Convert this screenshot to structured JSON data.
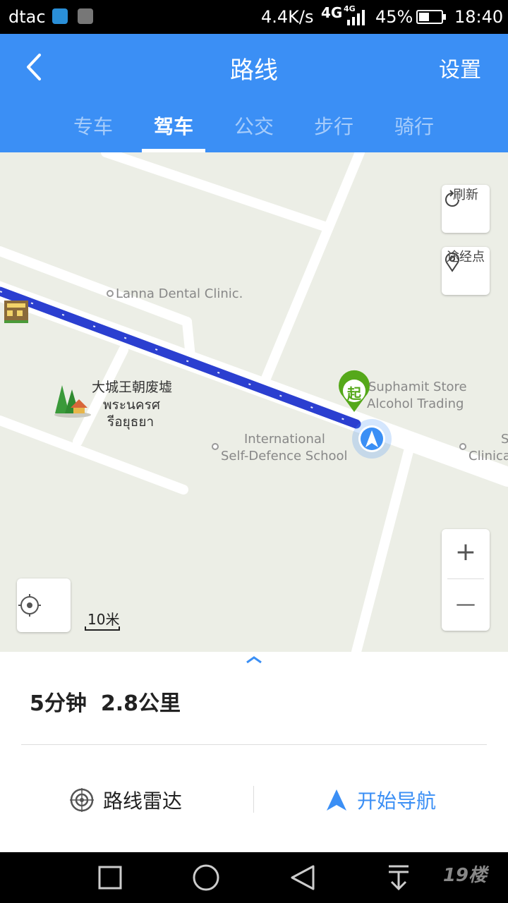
{
  "status_bar": {
    "carrier": "dtac",
    "net_speed": "4.4K/s",
    "network": "4G",
    "network_small": "4G",
    "battery": "45%",
    "battery_level": 0.45,
    "time": "18:40"
  },
  "header": {
    "title": "路线",
    "settings": "设置",
    "tabs": [
      {
        "label": "专车",
        "active": false
      },
      {
        "label": "驾车",
        "active": true
      },
      {
        "label": "公交",
        "active": false
      },
      {
        "label": "步行",
        "active": false
      },
      {
        "label": "骑行",
        "active": false
      }
    ]
  },
  "map": {
    "labels": {
      "lanna": "Lanna Dental Clinic.",
      "ayutthaya_cn": "大城王朝废墟",
      "ayutthaya_th1": "พระนครศ",
      "ayutthaya_th2": "รีอยุธยา",
      "suphamit1": "Suphamit Store",
      "suphamit2": "Alcohol Trading",
      "school1": "International",
      "school2": "Self-Defence School",
      "clinic": "Clinica",
      "s": "S"
    },
    "start_marker": "起",
    "refresh": "刷新",
    "waypoint": "途经点",
    "zoom_in": "+",
    "zoom_out": "—",
    "scale": "10米",
    "route_color": "#2b3fd0"
  },
  "panel": {
    "duration": "5分钟",
    "distance": "2.8公里",
    "radar": "路线雷达",
    "start_nav": "开始导航"
  },
  "watermark": "19楼"
}
